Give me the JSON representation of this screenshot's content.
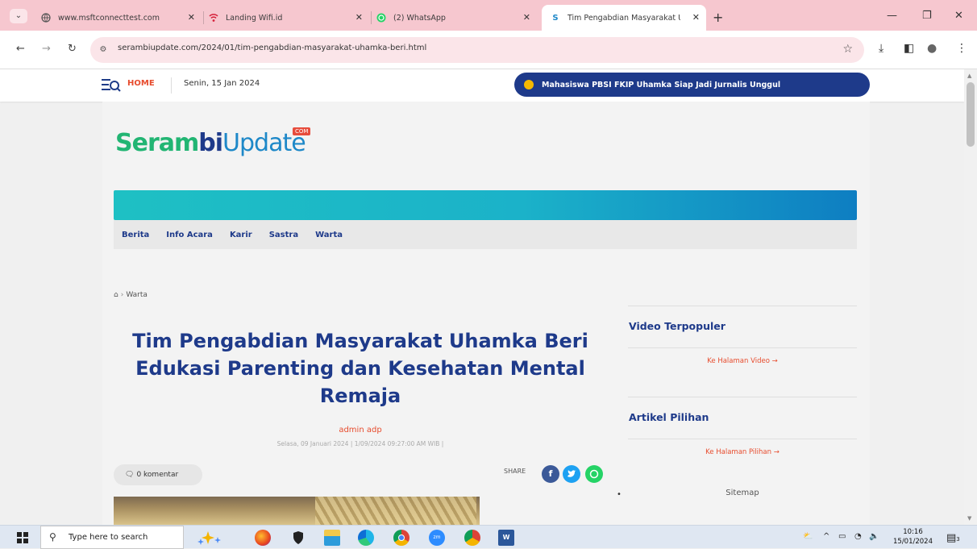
{
  "browser": {
    "tabs": [
      {
        "title": "www.msftconnecttest.com",
        "active": false
      },
      {
        "title": "Landing Wifi.id",
        "active": false
      },
      {
        "title": "(2) WhatsApp",
        "active": false
      },
      {
        "title": "Tim Pengabdian Masyarakat Ul",
        "active": true
      }
    ],
    "url": "serambiupdate.com/2024/01/tim-pengabdian-masyarakat-uhamka-beri.html",
    "icons": {
      "tab_search": "⌄",
      "close": "✕",
      "new_tab": "+",
      "minimize": "—",
      "maximize": "❐",
      "back": "←",
      "forward": "→",
      "reload": "↻",
      "site_info": "⚙",
      "star": "☆",
      "download": "⤓",
      "sidebar": "◧",
      "profile": "●",
      "menu": "⋮"
    }
  },
  "site": {
    "topbar": {
      "home_label": "HOME",
      "date": "Senin, 15 Jan 2024",
      "ticker_text": "Mahasiswa PBSI FKIP Uhamka Siap Jadi Jurnalis Unggul"
    },
    "logo": {
      "part1": "Seram",
      "part2": "bi",
      "part3": "Update",
      "badge": "COM"
    },
    "nav": [
      "Berita",
      "Info Acara",
      "Karir",
      "Sastra",
      "Warta"
    ],
    "breadcrumb": {
      "home_icon": "⌂",
      "separator": "›",
      "current": "Warta"
    },
    "article": {
      "title": "Tim Pengabdian Masyarakat Uhamka Beri Edukasi Parenting dan Kesehatan Mental Remaja",
      "author": "admin adp",
      "meta": "Selasa, 09 Januari 2024 | 1/09/2024 09:27:00 AM WIB |",
      "comments": "0 komentar",
      "comment_icon": "🗨",
      "share_label": "SHARE"
    },
    "sidebar": {
      "video_heading": "Video Terpopuler",
      "video_link": "Ke Halaman Video →",
      "pilihan_heading": "Artikel Pilihan",
      "pilihan_link": "Ke Halaman Pilihan →",
      "sitemap": "Sitemap",
      "bullet": "•"
    }
  },
  "taskbar": {
    "search_placeholder": "Type here to search",
    "time": "10:16",
    "date": "15/01/2024",
    "notification_count": "3"
  },
  "colors": {
    "brand_blue": "#1e3a8a",
    "accent_orange": "#e74c2e",
    "brand_green": "#22b573",
    "tab_bar": "#f6c7cf"
  }
}
